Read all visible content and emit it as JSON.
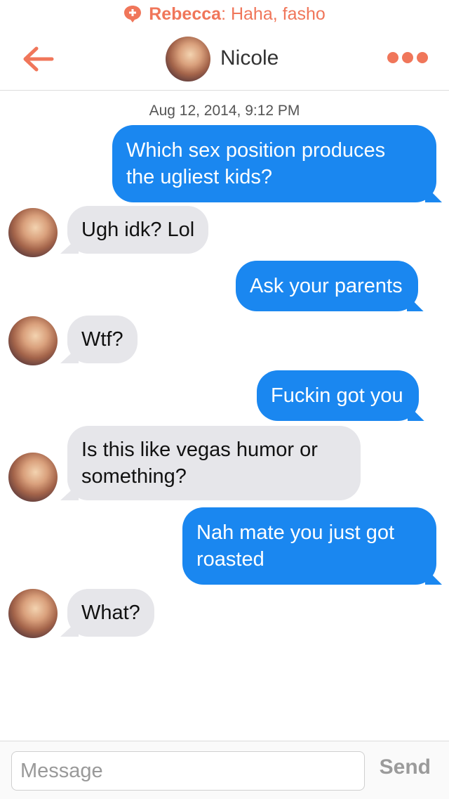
{
  "notification": {
    "sender": "Rebecca",
    "separator": ":",
    "text": " Haha, fasho"
  },
  "header": {
    "title": "Nicole"
  },
  "timestamp": "Aug 12, 2014, 9:12 PM",
  "messages": [
    {
      "direction": "outgoing",
      "lines": [
        "Which sex position produces",
        "the ugliest kids?"
      ]
    },
    {
      "direction": "incoming",
      "lines": [
        "Ugh idk? Lol"
      ]
    },
    {
      "direction": "outgoing",
      "lines": [
        "Ask your parents"
      ]
    },
    {
      "direction": "incoming",
      "lines": [
        "Wtf?"
      ]
    },
    {
      "direction": "outgoing",
      "lines": [
        "Fuckin got you"
      ]
    },
    {
      "direction": "incoming",
      "lines": [
        "Is this like vegas humor or",
        "something?"
      ]
    },
    {
      "direction": "outgoing",
      "lines": [
        "Nah mate you just got",
        "roasted"
      ]
    },
    {
      "direction": "incoming",
      "lines": [
        "What?"
      ]
    }
  ],
  "composer": {
    "placeholder": "Message",
    "send_label": "Send"
  },
  "colors": {
    "accent": "#f0765a",
    "outgoing_bubble": "#1a87f0",
    "incoming_bubble": "#e6e6ea"
  }
}
